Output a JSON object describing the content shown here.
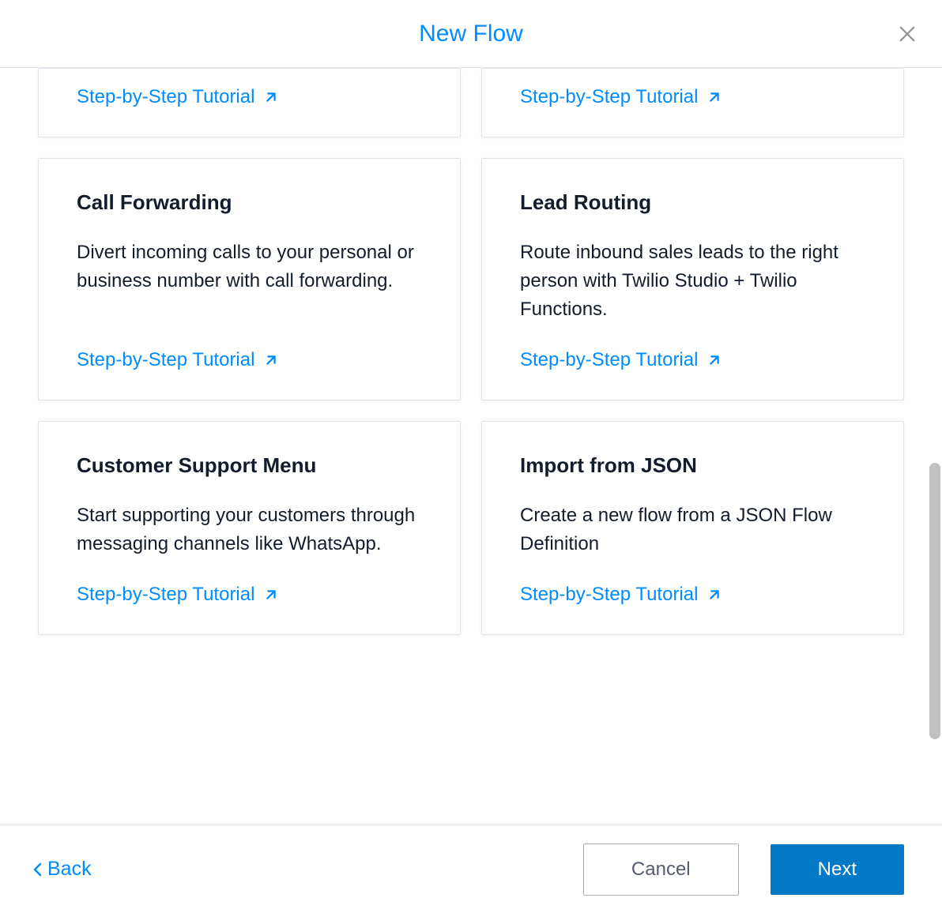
{
  "header": {
    "title": "New Flow"
  },
  "cards": [
    {
      "title": "",
      "description": "",
      "tutorial_label": "Step-by-Step Tutorial",
      "cutoff": true
    },
    {
      "title": "",
      "description": "",
      "tutorial_label": "Step-by-Step Tutorial",
      "cutoff": true
    },
    {
      "title": "Call Forwarding",
      "description": "Divert incoming calls to your personal or business number with call forwarding.",
      "tutorial_label": "Step-by-Step Tutorial",
      "cutoff": false
    },
    {
      "title": "Lead Routing",
      "description": "Route inbound sales leads to the right person with Twilio Studio + Twilio Functions.",
      "tutorial_label": "Step-by-Step Tutorial",
      "cutoff": false
    },
    {
      "title": "Customer Support Menu",
      "description": "Start supporting your customers through messaging channels like WhatsApp.",
      "tutorial_label": "Step-by-Step Tutorial",
      "cutoff": false
    },
    {
      "title": "Import from JSON",
      "description": "Create a new flow from a JSON Flow Definition",
      "tutorial_label": "Step-by-Step Tutorial",
      "cutoff": false
    }
  ],
  "footer": {
    "back_label": "Back",
    "cancel_label": "Cancel",
    "next_label": "Next"
  }
}
